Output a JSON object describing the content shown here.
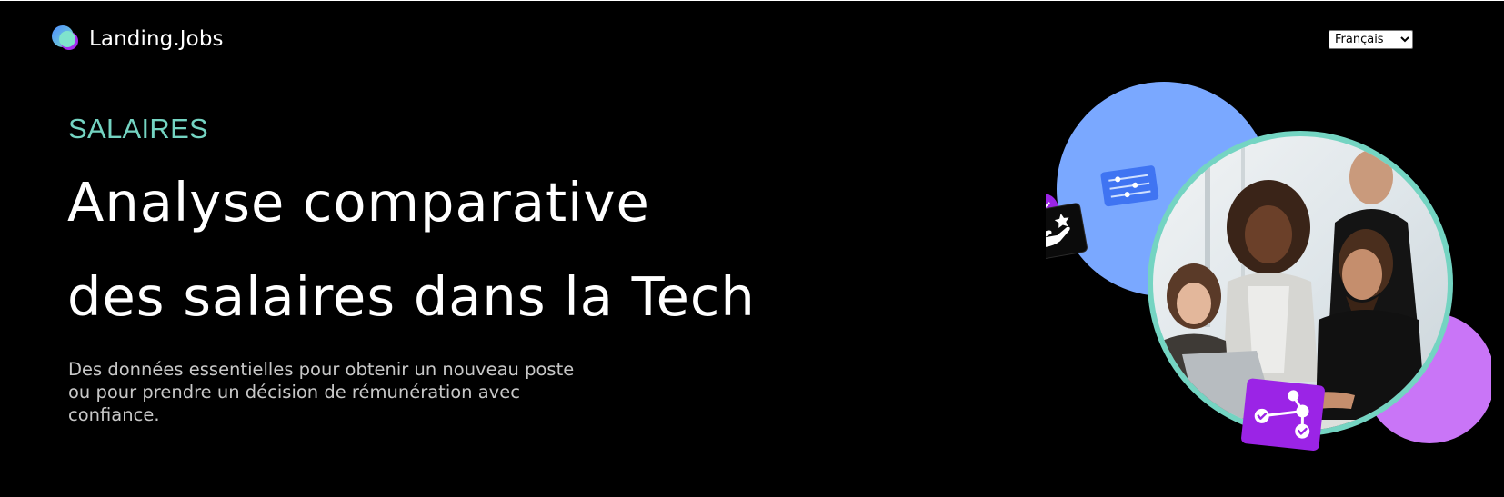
{
  "header": {
    "logo_text": "Landing.Jobs",
    "language_select": {
      "selected": "Français"
    }
  },
  "hero": {
    "eyebrow": "SALAIRES",
    "title_line_1": "Analyse comparative",
    "title_line_2": "des salaires dans la Tech",
    "description": "Des données essentielles pour obtenir un nouveau poste ou pour prendre un décision de rémunération avec confiance."
  },
  "colors": {
    "background": "#000000",
    "accent_teal": "#74d4c2",
    "blue_blob": "#7aa8ff",
    "purple_blob": "#c975f7",
    "purple_badge": "#9b24e6",
    "blue_card": "#3f74f2"
  },
  "illustration": {
    "icons": [
      "sparkle-badge-icon",
      "sliders-card-icon",
      "hand-star-icon",
      "network-check-icon"
    ]
  }
}
